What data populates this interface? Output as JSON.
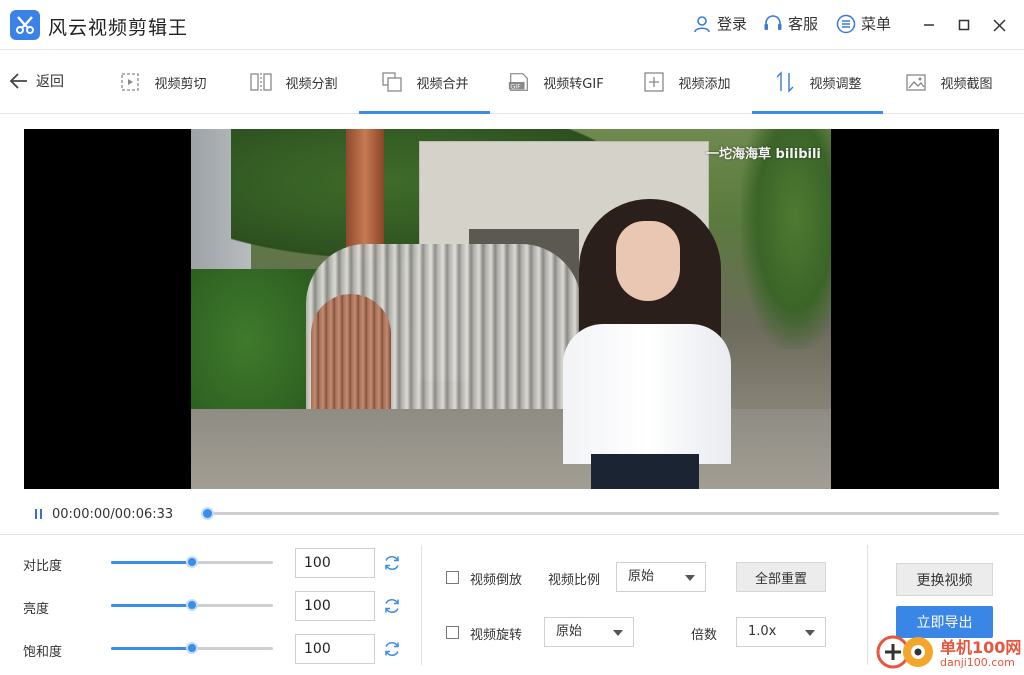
{
  "app": {
    "title": "风云视频剪辑王",
    "accent": "#3a8ee6"
  },
  "titlebar": {
    "login_label": "登录",
    "login_icon": "user-icon",
    "service_label": "客服",
    "service_icon": "headset-icon",
    "menu_label": "菜单",
    "menu_icon": "list-icon"
  },
  "nav": {
    "back_label": "返回",
    "tabs": [
      {
        "label": "视频剪切",
        "icon": "scissor-frame-icon",
        "active": false
      },
      {
        "label": "视频分割",
        "icon": "split-icon",
        "active": false
      },
      {
        "label": "视频合并",
        "icon": "merge-icon",
        "active": true
      },
      {
        "label": "视频转GIF",
        "icon": "gif-icon",
        "active": false
      },
      {
        "label": "视频添加",
        "icon": "add-icon",
        "active": false
      },
      {
        "label": "视频调整",
        "icon": "adjust-arrows-icon",
        "active": true
      },
      {
        "label": "视频截图",
        "icon": "image-icon",
        "active": false
      }
    ]
  },
  "video": {
    "watermark": "一坨海海草 bilibili"
  },
  "playback": {
    "timecode": "00:00:00/00:06:33",
    "progress": 0.0
  },
  "adjustments": [
    {
      "label": "对比度",
      "value": "100",
      "level": 0.5
    },
    {
      "label": "亮度",
      "value": "100",
      "level": 0.5
    },
    {
      "label": "饱和度",
      "value": "100",
      "level": 0.5
    }
  ],
  "options": {
    "reverse_label": "视频倒放",
    "ratio_label": "视频比例",
    "ratio_value": "原始",
    "reset_all_label": "全部重置",
    "rotate_label": "视频旋转",
    "rotate_value": "原始",
    "speed_label": "倍数",
    "speed_value": "1.0x"
  },
  "actions": {
    "replace_label": "更换视频",
    "export_label": "立即导出"
  },
  "site": {
    "name": "单机100网",
    "url": "danji100.com"
  }
}
